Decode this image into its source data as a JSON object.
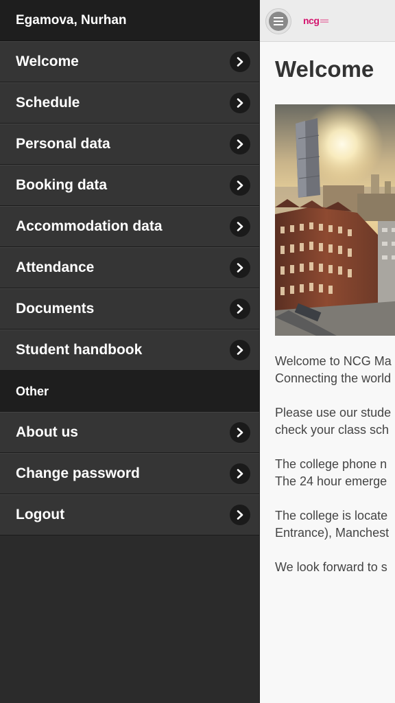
{
  "sidebar": {
    "user_name": "Egamova, Nurhan",
    "items": [
      {
        "label": "Welcome"
      },
      {
        "label": "Schedule"
      },
      {
        "label": "Personal data"
      },
      {
        "label": "Booking data"
      },
      {
        "label": "Accommodation data"
      },
      {
        "label": "Attendance"
      },
      {
        "label": "Documents"
      },
      {
        "label": "Student handbook"
      }
    ],
    "other_header": "Other",
    "other_items": [
      {
        "label": "About us"
      },
      {
        "label": "Change password"
      },
      {
        "label": "Logout"
      }
    ]
  },
  "main": {
    "logo_text": "ncg",
    "title": "Welcome",
    "paragraphs": [
      {
        "line1": "Welcome to NCG Ma",
        "line2": "Connecting the world"
      },
      {
        "line1": "Please use our stude",
        "line2": "check your class sch"
      },
      {
        "line1": "The college phone n",
        "line2": "The 24 hour emerge"
      },
      {
        "line1": "The college is locate",
        "line2": "Entrance), Manchest"
      },
      {
        "line1": "We look forward to s",
        "line2": ""
      }
    ]
  },
  "colors": {
    "sidebar_bg": "#2b2b2b",
    "sidebar_header_bg": "#1e1e1e",
    "menu_item_bg": "#353535",
    "brand": "#d4146e",
    "content_bg": "#f8f8f8"
  },
  "icons": {
    "menu_chevron": "chevron-right-icon",
    "menu_button": "hamburger-menu-icon"
  }
}
